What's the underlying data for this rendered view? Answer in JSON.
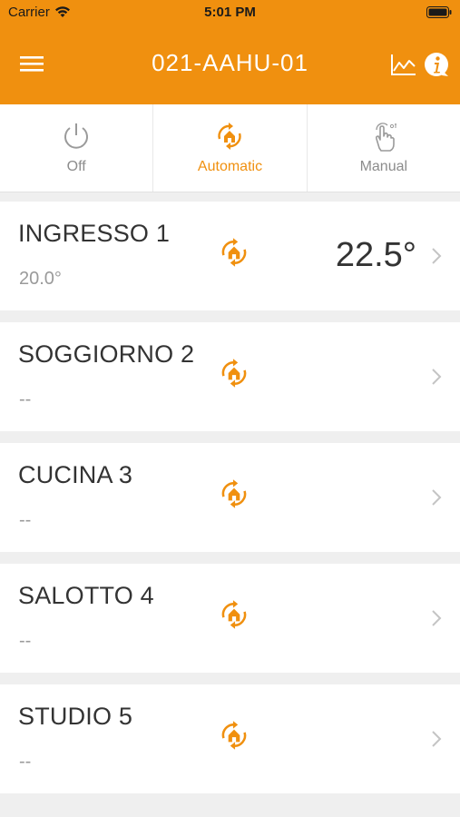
{
  "status_bar": {
    "carrier": "Carrier",
    "time": "5:01 PM"
  },
  "nav": {
    "title": "021-AAHU-01"
  },
  "modes": [
    {
      "label": "Off",
      "icon": "power-icon",
      "active": false
    },
    {
      "label": "Automatic",
      "icon": "auto-mode-icon",
      "active": true
    },
    {
      "label": "Manual",
      "icon": "hand-touch-icon",
      "active": false
    }
  ],
  "zones": [
    {
      "name": "INGRESSO 1",
      "sub": "20.0°",
      "temp": "22.5°"
    },
    {
      "name": "SOGGIORNO 2",
      "sub": "--",
      "temp": ""
    },
    {
      "name": "CUCINA 3",
      "sub": "--",
      "temp": ""
    },
    {
      "name": "SALOTTO 4",
      "sub": "--",
      "temp": ""
    },
    {
      "name": "STUDIO 5",
      "sub": "--",
      "temp": ""
    }
  ],
  "colors": {
    "accent": "#f0900f",
    "background": "#efefef",
    "text": "#333333",
    "muted": "#9a9a9a"
  }
}
